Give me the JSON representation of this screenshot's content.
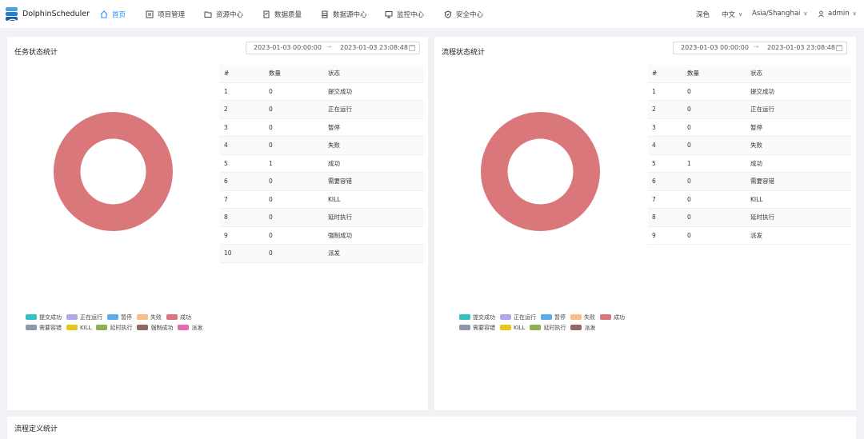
{
  "app": {
    "brand": "DolphinScheduler"
  },
  "nav": {
    "items": [
      {
        "label": "首页",
        "active": true
      },
      {
        "label": "项目管理"
      },
      {
        "label": "资源中心"
      },
      {
        "label": "数据质量"
      },
      {
        "label": "数据源中心"
      },
      {
        "label": "监控中心"
      },
      {
        "label": "安全中心"
      }
    ],
    "theme": "深色",
    "language": "中文",
    "timezone": "Asia/Shanghai",
    "user": "admin"
  },
  "task_panel": {
    "title": "任务状态统计",
    "date_start": "2023-01-03 00:00:00",
    "date_end": "2023-01-03 23:08:48",
    "columns": [
      "#",
      "数量",
      "状态"
    ],
    "rows": [
      [
        "1",
        "0",
        "提交成功"
      ],
      [
        "2",
        "0",
        "正在运行"
      ],
      [
        "3",
        "0",
        "暂停"
      ],
      [
        "4",
        "0",
        "失败"
      ],
      [
        "5",
        "1",
        "成功"
      ],
      [
        "6",
        "0",
        "需要容错"
      ],
      [
        "7",
        "0",
        "KILL"
      ],
      [
        "8",
        "0",
        "延时执行"
      ],
      [
        "9",
        "0",
        "强制成功"
      ],
      [
        "10",
        "0",
        "派发"
      ]
    ],
    "legend": [
      {
        "label": "提交成功",
        "color": "#36c2c2"
      },
      {
        "label": "正在运行",
        "color": "#b5a6e6"
      },
      {
        "label": "暂停",
        "color": "#5aacea"
      },
      {
        "label": "失败",
        "color": "#f9bd8a"
      },
      {
        "label": "成功",
        "color": "#d9777b"
      },
      {
        "label": "需要容错",
        "color": "#8c98ad"
      },
      {
        "label": "KILL",
        "color": "#e4c91b"
      },
      {
        "label": "延时执行",
        "color": "#8db050"
      },
      {
        "label": "强制成功",
        "color": "#8f6a63"
      },
      {
        "label": "派发",
        "color": "#e36bb6"
      }
    ]
  },
  "process_panel": {
    "title": "流程状态统计",
    "date_start": "2023-01-03 00:00:00",
    "date_end": "2023-01-03 23:08:48",
    "columns": [
      "#",
      "数量",
      "状态"
    ],
    "rows": [
      [
        "1",
        "0",
        "提交成功"
      ],
      [
        "2",
        "0",
        "正在运行"
      ],
      [
        "3",
        "0",
        "暂停"
      ],
      [
        "4",
        "0",
        "失败"
      ],
      [
        "5",
        "1",
        "成功"
      ],
      [
        "6",
        "0",
        "需要容错"
      ],
      [
        "7",
        "0",
        "KILL"
      ],
      [
        "8",
        "0",
        "延时执行"
      ],
      [
        "9",
        "0",
        "派发"
      ]
    ],
    "legend": [
      {
        "label": "提交成功",
        "color": "#36c2c2"
      },
      {
        "label": "正在运行",
        "color": "#b5a6e6"
      },
      {
        "label": "暂停",
        "color": "#5aacea"
      },
      {
        "label": "失败",
        "color": "#f9bd8a"
      },
      {
        "label": "成功",
        "color": "#d9777b"
      },
      {
        "label": "需要容错",
        "color": "#8c98ad"
      },
      {
        "label": "KILL",
        "color": "#e4c91b"
      },
      {
        "label": "延时执行",
        "color": "#8db050"
      },
      {
        "label": "派发",
        "color": "#8f6a63"
      }
    ]
  },
  "definition_panel": {
    "title": "流程定义统计"
  },
  "colors": {
    "accent": "#1890ff",
    "success": "#d9777b"
  }
}
